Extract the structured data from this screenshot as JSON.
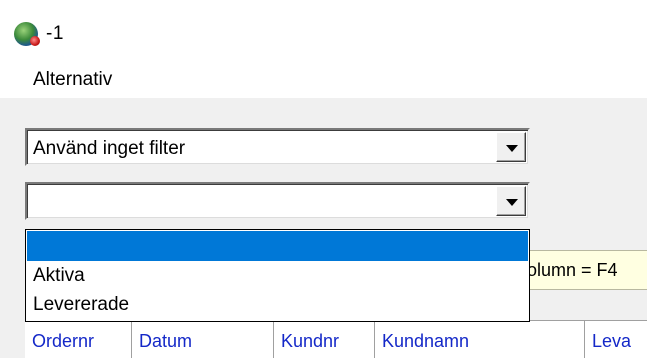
{
  "window": {
    "title": "-1",
    "icon": "globe-magnifier-icon"
  },
  "menu": {
    "items": [
      {
        "label": "Alternativ"
      }
    ]
  },
  "filters": {
    "filter_combo": {
      "value": "Använd inget filter"
    },
    "status_combo": {
      "value": "",
      "options": [
        "",
        "Aktiva",
        "Levererade"
      ],
      "selected_index": 0
    }
  },
  "hint": {
    "text": "olumn = F4"
  },
  "grid": {
    "columns": [
      "Ordernr",
      "Datum",
      "Kundnr",
      "Kundnamn",
      "Leva"
    ]
  },
  "colors": {
    "selection": "#0078d7",
    "column_header_text": "#1428c8",
    "hint_background": "#ffffe1"
  }
}
